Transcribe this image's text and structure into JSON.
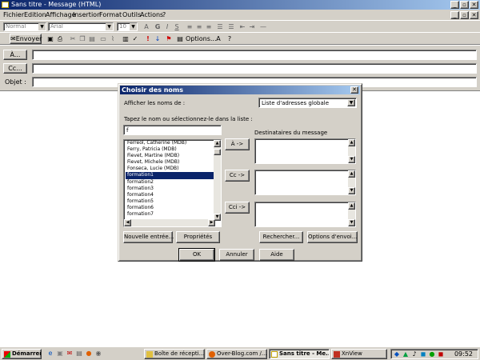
{
  "window": {
    "title": "Sans titre - Message (HTML)"
  },
  "menu": [
    "Fichier",
    "Edition",
    "Affichage",
    "Insertion",
    "Format",
    "Outils",
    "Actions",
    "?"
  ],
  "toolbar1": {
    "style_combo": "Normal",
    "font_combo": "Arial",
    "size_combo": "10"
  },
  "toolbar2": {
    "send_label": "Envoyer",
    "options_label": "Options..."
  },
  "address": {
    "to_button": "À...",
    "cc_button": "Cc...",
    "subject_label": "Objet :"
  },
  "dialog": {
    "title": "Choisir des noms",
    "show_names_label": "Afficher les noms de :",
    "address_book": "Liste d'adresses globale",
    "type_label": "Tapez le nom ou sélectionnez-le dans la liste :",
    "search_value": "f",
    "recipients_label": "Destinataires du message",
    "names": [
      "Ferreol, Catherine (MDB)",
      "Ferry, Patricia (MDB)",
      "Fievet, Martine (MDB)",
      "Fievet, Michele (MDB)",
      "Fonseca, Lucie (MDB)",
      "formation1",
      "formation2",
      "formation3",
      "formation4",
      "formation5",
      "formation6",
      "formation7"
    ],
    "selected_index": 5,
    "to_btn": "À ->",
    "cc_btn": "Cc ->",
    "bcc_btn": "Cci ->",
    "new_entry_btn": "Nouvelle entrée...",
    "properties_btn": "Propriétés",
    "search_btn": "Rechercher...",
    "send_options_btn": "Options d'envoi...",
    "ok_btn": "OK",
    "cancel_btn": "Annuler",
    "help_btn": "Aide"
  },
  "taskbar": {
    "start": "Démarrer",
    "tasks": [
      "Boîte de récepti...",
      "Over-Blog.com /...",
      "Sans titre - Me...",
      "XnView"
    ],
    "clock": "09:52"
  }
}
